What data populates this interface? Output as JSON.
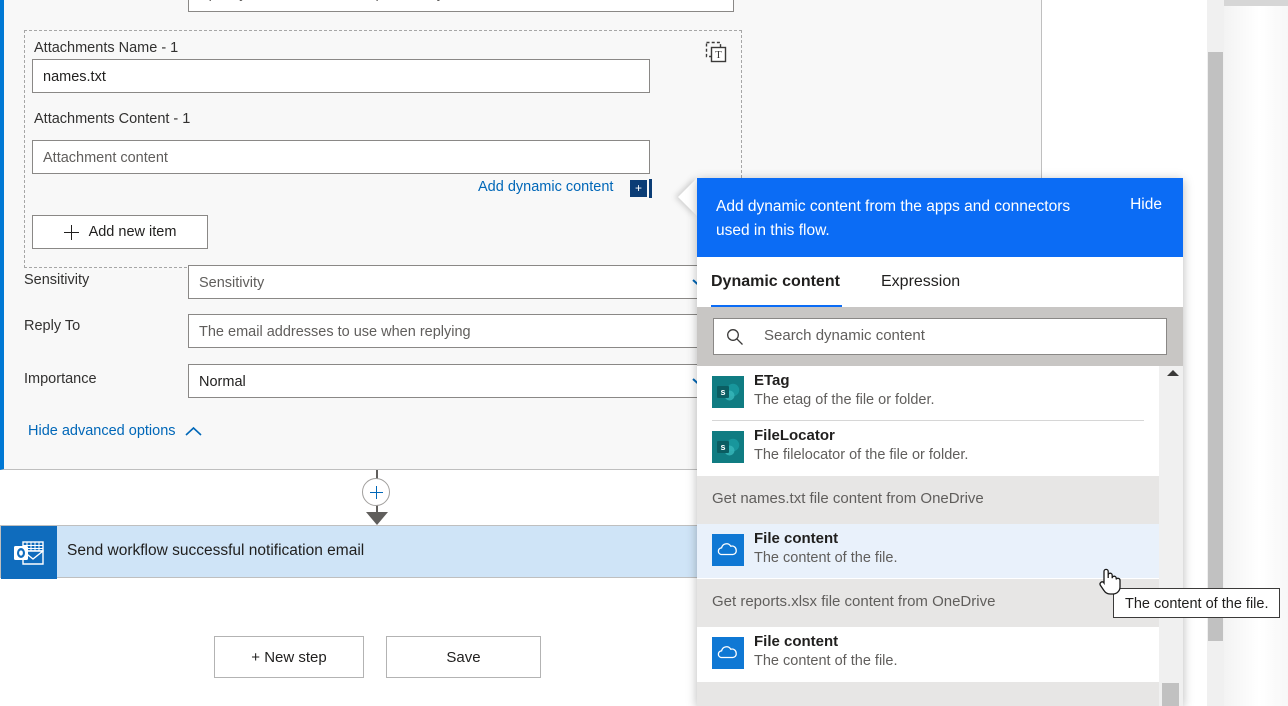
{
  "flow": {
    "to_field_placeholder": "Specify email addresses separated by semicolons like someone@contoso.com",
    "attachments": {
      "name_label": "Attachments Name - 1",
      "name_value": "names.txt",
      "content_label": "Attachments Content - 1",
      "content_placeholder": "Attachment content",
      "text_mode_icon": "text-mode-icon",
      "add_dynamic_content_link": "Add dynamic content",
      "add_dynamic_content_plus": "+",
      "add_new_item_label": "Add new item"
    },
    "advanced_rows": [
      {
        "label": "Sensitivity",
        "value": "Sensitivity",
        "is_placeholder": true,
        "has_chevron": true
      },
      {
        "label": "Reply To",
        "value": "The email addresses to use when replying",
        "is_placeholder": true,
        "has_chevron": false
      },
      {
        "label": "Importance",
        "value": "Normal",
        "is_placeholder": false,
        "has_chevron": true
      }
    ],
    "hide_advanced_label": "Hide advanced options"
  },
  "next_card": {
    "title": "Send workflow successful notification email",
    "icon": "outlook-icon"
  },
  "actions": {
    "new_step_label": "+ New step",
    "save_label": "Save"
  },
  "flyout": {
    "banner_text": "Add dynamic content from the apps and connectors used in this flow.",
    "hide_label": "Hide",
    "tabs": [
      {
        "label": "Dynamic content",
        "active": true
      },
      {
        "label": "Expression",
        "active": false
      }
    ],
    "search_placeholder": "Search dynamic content",
    "items": [
      {
        "kind": "item",
        "name": "ETag",
        "desc": "The etag of the file or folder.",
        "icon": "sharepoint-icon",
        "hovered": false
      },
      {
        "kind": "sep"
      },
      {
        "kind": "item",
        "name": "FileLocator",
        "desc": "The filelocator of the file or folder.",
        "icon": "sharepoint-icon",
        "hovered": false
      },
      {
        "kind": "group",
        "name": "Get names.txt file content from OneDrive"
      },
      {
        "kind": "item",
        "name": "File content",
        "desc": "The content of the file.",
        "icon": "onedrive-icon",
        "hovered": true
      },
      {
        "kind": "group",
        "name": "Get reports.xlsx file content from OneDrive"
      },
      {
        "kind": "item",
        "name": "File content",
        "desc": "The content of the file.",
        "icon": "onedrive-icon",
        "hovered": false
      }
    ]
  },
  "tooltip": {
    "text": "The content of the file."
  },
  "colors": {
    "accent_blue": "#0b6cf5",
    "link_blue": "#0067b8",
    "card_border_blue": "#0078d4",
    "sharepoint_teal": "#107C82",
    "onedrive_blue": "#0f78d4",
    "outlook_blue": "#0f6cbd",
    "highlight_row": "#e9f1fb",
    "selected_card": "#cfe4f7",
    "group_header_gray": "#e7e6e5"
  }
}
